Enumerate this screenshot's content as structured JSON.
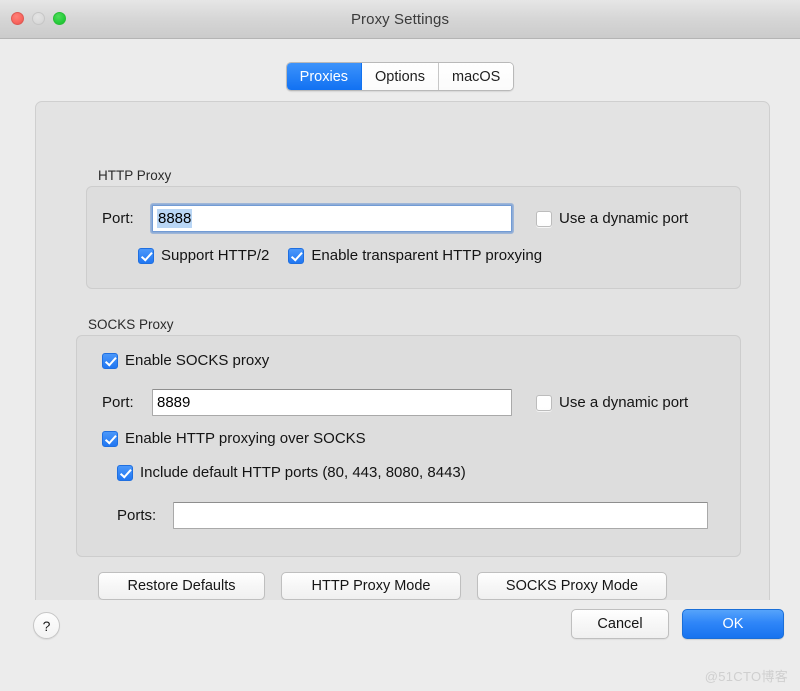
{
  "window": {
    "title": "Proxy Settings",
    "traffic_lights": {
      "close": "close-button",
      "minimize": "minimize-button",
      "maximize": "maximize-button"
    }
  },
  "tabs": [
    {
      "label": "Proxies",
      "active": true
    },
    {
      "label": "Options",
      "active": false
    },
    {
      "label": "macOS",
      "active": false
    }
  ],
  "http_proxy": {
    "group_label": "HTTP Proxy",
    "port_label": "Port:",
    "port_value": "8888",
    "port_focused": true,
    "port_selected": true,
    "dynamic_port": {
      "label": "Use a dynamic port",
      "checked": false
    },
    "support_http2": {
      "label": "Support HTTP/2",
      "checked": true
    },
    "transparent_proxying": {
      "label": "Enable transparent HTTP proxying",
      "checked": true
    }
  },
  "socks_proxy": {
    "group_label": "SOCKS Proxy",
    "enable_socks": {
      "label": "Enable SOCKS proxy",
      "checked": true
    },
    "port_label": "Port:",
    "port_value": "8889",
    "dynamic_port": {
      "label": "Use a dynamic port",
      "checked": false
    },
    "http_over_socks": {
      "label": "Enable HTTP proxying over SOCKS",
      "checked": true
    },
    "include_default_ports": {
      "label": "Include default HTTP ports (80, 443, 8080, 8443)",
      "checked": true
    },
    "ports_label": "Ports:",
    "ports_value": "",
    "ports_placeholder": ""
  },
  "mode_buttons": [
    {
      "label": "Restore Defaults"
    },
    {
      "label": "HTTP Proxy Mode"
    },
    {
      "label": "SOCKS Proxy Mode"
    }
  ],
  "footer": {
    "help_label": "?",
    "cancel_label": "Cancel",
    "ok_label": "OK",
    "watermark": "@51CTO博客"
  },
  "colors": {
    "accent_blue": "#2177f2",
    "window_bg": "#ececec",
    "panel_bg": "#e3e3e3",
    "group_bg": "#dddddd",
    "selection_blue": "#b9d6f5"
  }
}
